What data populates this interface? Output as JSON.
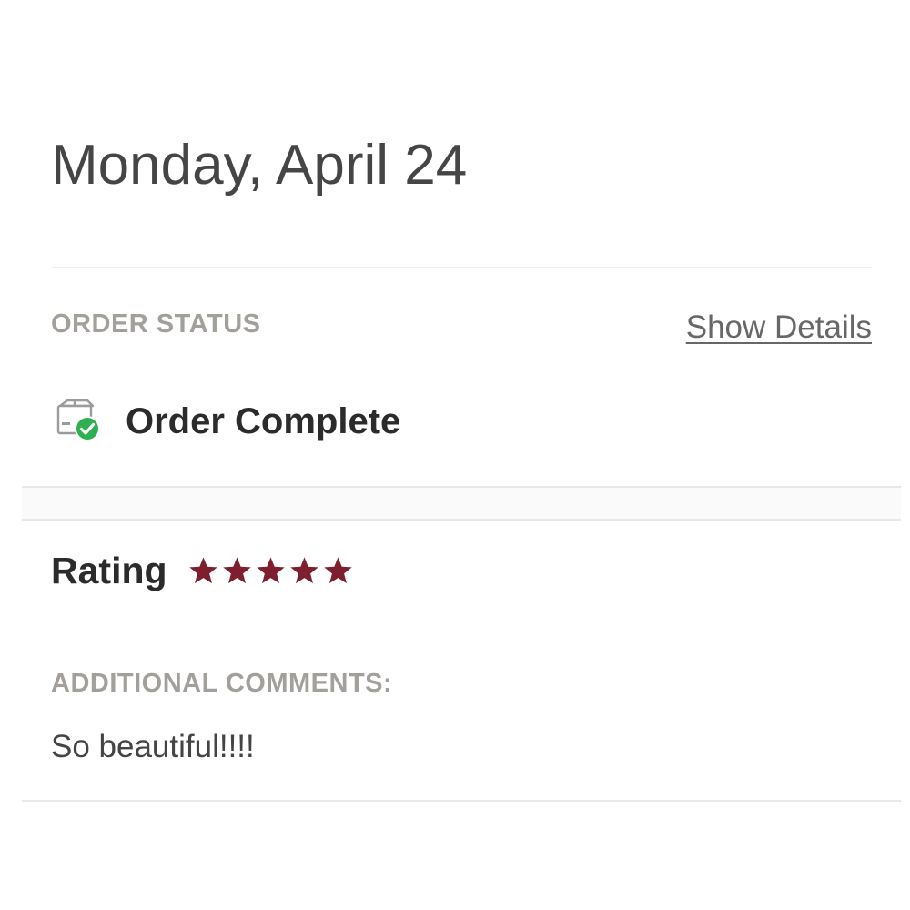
{
  "order": {
    "date": "Monday, April 24",
    "status_label": "ORDER STATUS",
    "show_details": "Show Details",
    "status_text": "Order Complete",
    "status_icon": "package-check-icon"
  },
  "review": {
    "rating_label": "Rating",
    "rating": 5,
    "rating_max": 5,
    "star_color": "#7e1f2f",
    "comments_label": "ADDITIONAL COMMENTS:",
    "comment": "So beautiful!!!!"
  },
  "colors": {
    "success": "#2fb050",
    "label_gray": "#a3a09b",
    "link_gray": "#676767"
  }
}
